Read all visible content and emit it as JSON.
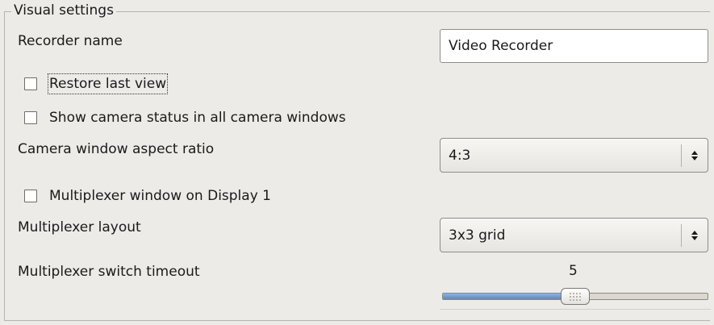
{
  "group": {
    "title": "Visual settings"
  },
  "recorder_name": {
    "label": "Recorder name",
    "value": "Video Recorder"
  },
  "restore_last_view": {
    "label": "Restore last view",
    "checked": false
  },
  "show_camera_status": {
    "label": "Show camera status in all camera windows",
    "checked": false
  },
  "aspect_ratio": {
    "label": "Camera window aspect ratio",
    "selected": "4:3"
  },
  "multiplexer_display": {
    "label": "Multiplexer window on Display 1",
    "checked": false
  },
  "multiplexer_layout": {
    "label": "Multiplexer layout",
    "selected": "3x3 grid"
  },
  "switch_timeout": {
    "label": "Multiplexer switch timeout",
    "value": "5",
    "fraction": 0.5
  },
  "colors": {
    "slider_fill": "#5a87c4",
    "background": "#edebe7"
  },
  "icons": {
    "combo_arrow": "up-down-arrows-icon",
    "slider_grip": "grip-icon"
  }
}
